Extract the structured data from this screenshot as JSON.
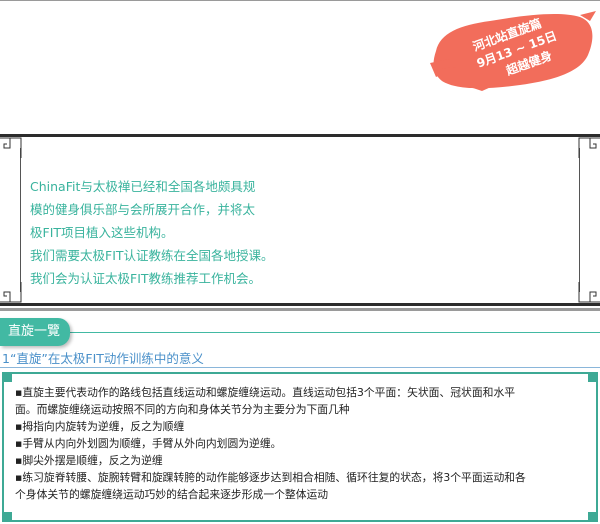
{
  "promo": {
    "line1": "河北站直旋篇",
    "line2": "9月13 ~ 15日",
    "line3": "超越健身",
    "color": "#f26d5b"
  },
  "intro": {
    "lines": [
      "ChinaFit与太极禅已经和全国各地颇具规",
      "模的健身俱乐部与会所展开合作，并将太",
      "极FIT项目植入这些机构。",
      "我们需要太极FIT认证教练在全国各地授课。",
      "我们会为认证太极FIT教练推荐工作机会。"
    ],
    "color": "#39b39d"
  },
  "section": {
    "tab_label": "直旋一覽",
    "subheading": "1“直旋”在太极FIT动作训练中的意义",
    "accent": "#42b9a3"
  },
  "content": {
    "lines": [
      "▪直旋主要代表动作的路线包括直线运动和螺旋缠绕运动。直线运动包括3个平面：矢状面、冠状面和水平",
      "面。而螺旋缠绕运动按照不同的方向和身体关节分为主要分为下面几种",
      "▪拇指向内旋转为逆缠，反之为顺缠",
      "▪手臂从内向外划圆为顺缠，手臂从外向内划圆为逆缠。",
      "▪脚尖外摆是顺缠，反之为逆缠",
      "▪练习旋脊转腰、旋腕转臂和旋踝转胯的动作能够逐步达到相合相随、循环往复的状态，将3个平面运动和各",
      "个身体关节的螺旋缠绕运动巧妙的结合起来逐步形成一个整体运动"
    ]
  }
}
